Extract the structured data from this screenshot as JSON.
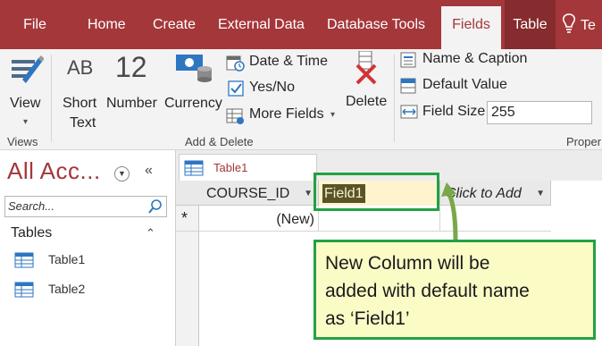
{
  "tabs": {
    "file": "File",
    "home": "Home",
    "create": "Create",
    "external_data": "External Data",
    "database_tools": "Database Tools",
    "fields": "Fields",
    "table": "Table",
    "tell_me": "Te"
  },
  "ribbon": {
    "views": {
      "view_button": "View",
      "group_label": "Views"
    },
    "add_delete": {
      "short_text_icon": "AB",
      "short_text_line1": "Short",
      "short_text_line2": "Text",
      "number_icon": "12",
      "number": "Number",
      "currency": "Currency",
      "date_time": "Date & Time",
      "yes_no": "Yes/No",
      "more_fields": "More Fields",
      "delete": "Delete",
      "group_label": "Add & Delete"
    },
    "properties": {
      "name_caption": "Name & Caption",
      "default_value": "Default Value",
      "field_size_label": "Field Size",
      "field_size_value": "255",
      "group_label": "Proper"
    }
  },
  "nav_pane": {
    "title": "All Acc...",
    "search_placeholder": "Search...",
    "group": "Tables",
    "items": [
      {
        "label": "Table1"
      },
      {
        "label": "Table2"
      }
    ]
  },
  "datasheet": {
    "doc_tab": "Table1",
    "columns": [
      "COURSE_ID",
      "Field1",
      "Click to Add"
    ],
    "new_row_marker": "*",
    "new_row_value": "(New)"
  },
  "annotation": {
    "text_line1": "New Column will be",
    "text_line2": "added with default name",
    "text_line3": "as ‘Field1’"
  },
  "colors": {
    "access_red": "#a4373a",
    "annotation_green": "#22a145",
    "callout_fill": "#fbfbc6"
  }
}
